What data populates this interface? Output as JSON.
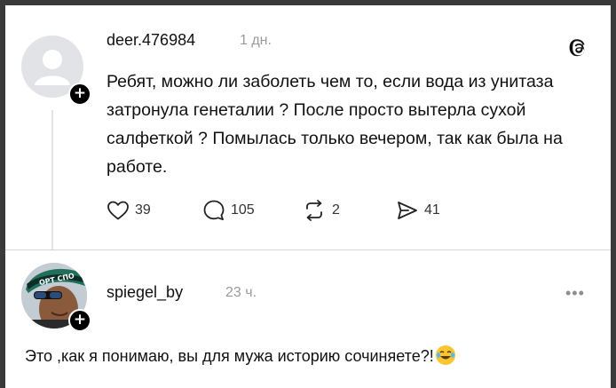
{
  "post": {
    "username": "deer.476984",
    "time": "1 дн.",
    "text": "Ребят, можно ли заболеть чем то, если вода из унитаза затронула генеталии ? После просто вытерла сухой салфеткой ? Помылась только вечером, так как была на работе.",
    "actions": {
      "likes": "39",
      "comments": "105",
      "reposts": "2",
      "shares": "41"
    }
  },
  "reply": {
    "username": "spiegel_by",
    "time": "23 ч.",
    "text": "Это ,как я понимаю, вы для мужа историю сочиняете?!",
    "emoji": "laughing-tears-emoji",
    "cap_text": "ОРТ СПО"
  },
  "icons": {
    "logo": "threads-icon",
    "more": "more-options-icon"
  },
  "colors": {
    "text": "#111111",
    "muted": "#9a9a9a",
    "background": "#ffffff",
    "frame": "#3a3a3a"
  }
}
